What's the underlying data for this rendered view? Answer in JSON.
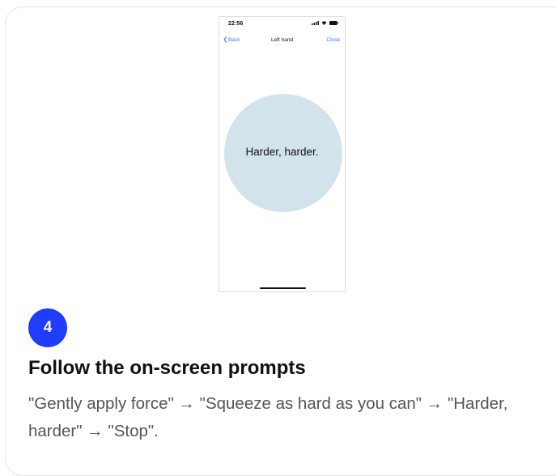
{
  "phone": {
    "status_time": "22:56",
    "nav": {
      "back_label": "Back",
      "title": "Left hand",
      "close_label": "Close"
    },
    "prompt_text": "Harder, harder.",
    "icons": {
      "back": "chevron-left-icon",
      "signal": "signal-icon",
      "wifi": "wifi-icon",
      "battery": "battery-icon"
    }
  },
  "step": {
    "number": "4",
    "title": "Follow the on-screen prompts",
    "description": "\"Gently apply force\" → \"Squeeze as hard as you can\" → \"Harder, harder\" → \"Stop\"."
  },
  "colors": {
    "accent": "#1f3cff",
    "ios_blue": "#3478f6",
    "circle": "#d3e3eb",
    "description_text": "#555555"
  }
}
